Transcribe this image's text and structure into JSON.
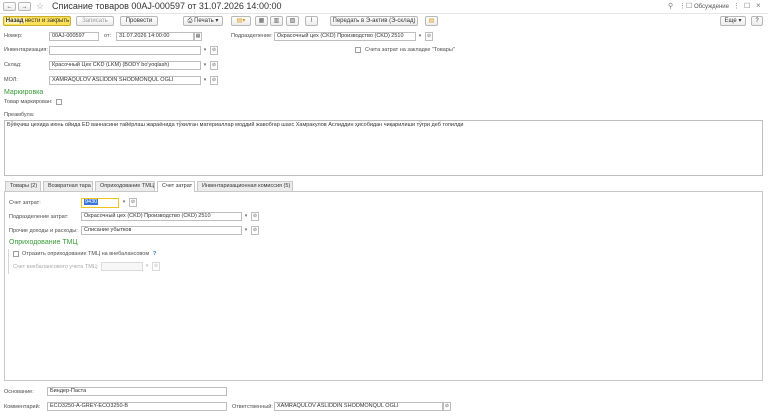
{
  "window": {
    "title": "Списание товаров 00AJ-000597 от 31.07.2026 14:00:00",
    "discussion_label": "Обсуждение",
    "more_label": "Еще",
    "help_label": "?"
  },
  "toolbar": {
    "back_close_label": "Назад",
    "post_close_label": "нести и закрыть",
    "write_label": "Записать",
    "post_label": "Провести",
    "print_label": "Печать",
    "transfer_label": "Передать в Э-актив (Э-склад)"
  },
  "header": {
    "number_label": "Номер:",
    "number_value": "00AJ-000597",
    "date_label": "от:",
    "date_value": "31.07.2026 14:00:00",
    "subdivision_label": "Подразделение:",
    "subdivision_value": "Окрасочный цех (CKD) Производство (CKD) 2510",
    "inventory_label": "Инвентаризация:",
    "inventory_value": "",
    "cost_accounts_label": "Счета затрат на закладке \"Товары\"",
    "warehouse_label": "Склад:",
    "warehouse_value": "Красочный Цех CKD (LKM) (BODY bo'yoqlash)",
    "mol_label": "МОЛ:",
    "mol_value": "XAMRAQULOV ASLIDDIN SHODMONQUL OGLI"
  },
  "marking": {
    "title": "Маркировка",
    "marked_label": "Товар маркирован:"
  },
  "preamble": {
    "label": "Преамбула:",
    "text": "Бўёқчиш цехида июнь ойида ED ваннасини тайёрлаш жараёнида тўкилган материаллар моддий жавобгар шахс Хамракулов Аслиддин ҳисобидан чиқарилиши тўғри деб топилди"
  },
  "tabs": [
    {
      "label": "Товары (2)"
    },
    {
      "label": "Возвратная тара"
    },
    {
      "label": "Оприходование ТМЦ"
    },
    {
      "label": "Счет затрат"
    },
    {
      "label": "Инвентаризационная комиссия (5)"
    }
  ],
  "cost_tab": {
    "account_label": "Счет затрат:",
    "account_value": "9430",
    "subdivision_label": "Подразделение затрат:",
    "subdivision_value": "Окрасочный цех (CKD) Производство (CKD) 2510",
    "other_label": "Прочие доходы и расходы:",
    "other_value": "Списание убытков",
    "tmc_title": "Оприходование ТМЦ",
    "offbalance_label": "Отразить оприходование ТМЦ на внебалансовом",
    "offbalance_help": "?",
    "offbalance_account_label": "Счет внебалансового учета ТМЦ:"
  },
  "footer": {
    "basis_label": "Основание:",
    "basis_value": "Биндер-Паста",
    "comment_label": "Комментарий:",
    "comment_value": "ECO3250-A-GREY-ECO3250-B",
    "responsible_label": "Ответственный:",
    "responsible_value": "XAMRAQULOV ASLIDDIN SHODMONQUL OGLI"
  },
  "colors": {
    "primary_button": "#fce05a",
    "section_title": "#3a9a3a",
    "focus_border": "#f0c419"
  }
}
